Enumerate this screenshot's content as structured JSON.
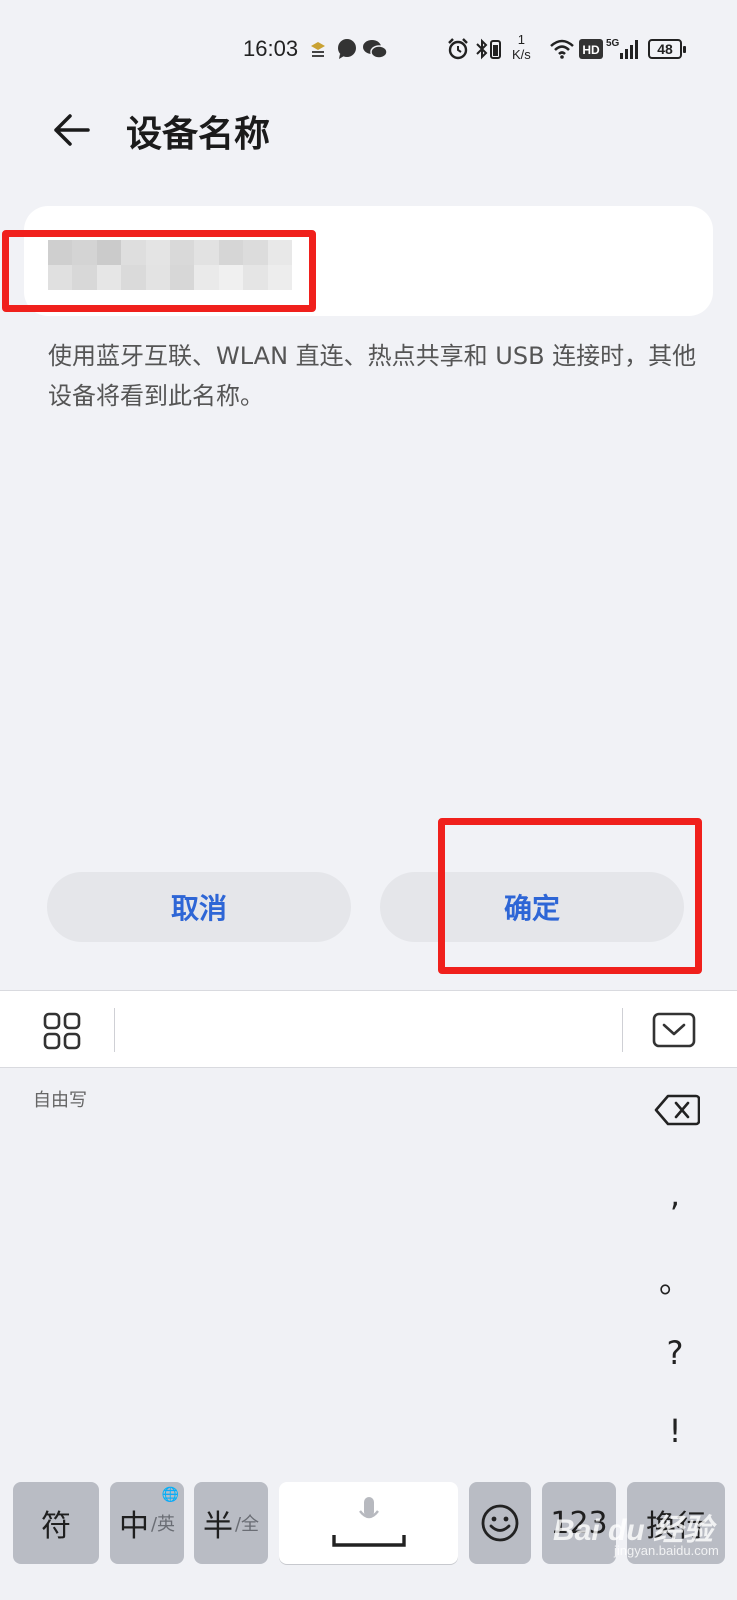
{
  "status_bar": {
    "time": "16:03",
    "net_speed_value": "1",
    "net_speed_unit": "K/s",
    "signal_label": "5G",
    "hd_label": "HD",
    "battery": "48"
  },
  "header": {
    "title": "设备名称"
  },
  "device_name": {
    "value": "",
    "hint": "使用蓝牙互联、WLAN 直连、热点共享和 USB 连接时，其他设备将看到此名称。"
  },
  "dialog_buttons": {
    "cancel": "取消",
    "confirm": "确定"
  },
  "keyboard": {
    "freewrite_label": "自由写",
    "punctuation": [
      ",",
      "。",
      "?",
      "!"
    ],
    "keys": {
      "symbol": "符",
      "lang_main": "中",
      "lang_alt": "/英",
      "width_main": "半",
      "width_alt": "/全",
      "numbers": "123",
      "enter": "换行"
    }
  },
  "watermark": {
    "main": "Bai du 经验",
    "sub": "jingyan.baidu.com"
  },
  "colors": {
    "accent_blue": "#2e66d6",
    "highlight_red": "#f0201c",
    "background": "#f1f2f6"
  }
}
